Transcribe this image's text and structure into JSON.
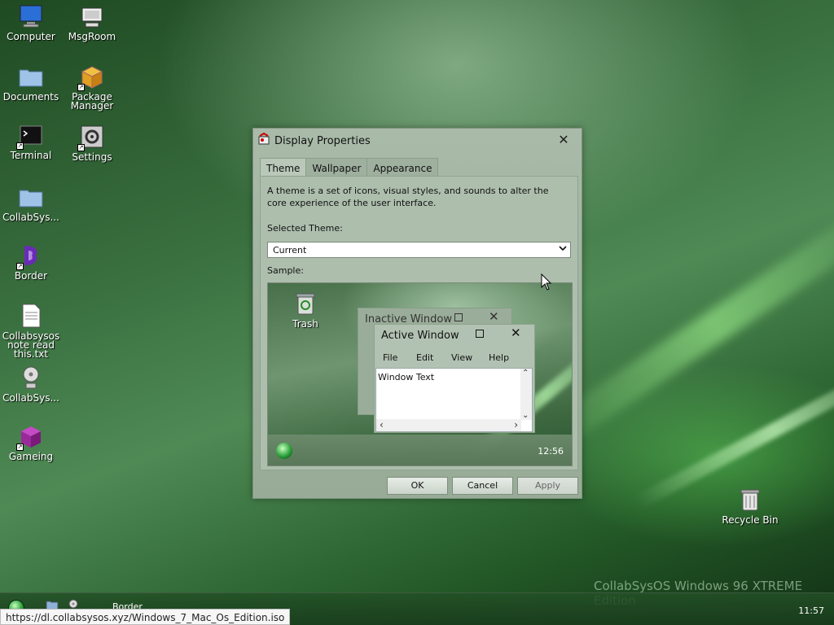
{
  "desktop": {
    "icons": [
      {
        "label": "Computer",
        "icon": "computer-icon",
        "shortcut": false
      },
      {
        "label": "MsgRoom",
        "icon": "msgroom-icon",
        "shortcut": false
      },
      {
        "label": "Documents",
        "icon": "folder-icon",
        "shortcut": false
      },
      {
        "label": "Package Manager",
        "icon": "package-icon",
        "shortcut": true
      },
      {
        "label": "Terminal",
        "icon": "terminal-icon",
        "shortcut": true
      },
      {
        "label": "Settings",
        "icon": "gear-icon",
        "shortcut": true
      },
      {
        "label": "CollabSys...",
        "icon": "folder-icon",
        "shortcut": false
      },
      {
        "label": "Border",
        "icon": "border-icon",
        "shortcut": true
      },
      {
        "label": "Collabsysos note read this.txt",
        "icon": "text-file-icon",
        "shortcut": false
      },
      {
        "label": "CollabSys...",
        "icon": "cd-icon",
        "shortcut": false
      },
      {
        "label": "Gameing",
        "icon": "cube-icon",
        "shortcut": true
      },
      {
        "label": "Recycle Bin",
        "icon": "recycle-bin-icon",
        "shortcut": false
      }
    ],
    "watermark": "CollabSysOS Windows 96 XTREME Edition"
  },
  "dialog": {
    "title": "Display Properties",
    "close_label": "✕",
    "tabs": [
      {
        "label": "Theme",
        "active": true
      },
      {
        "label": "Wallpaper",
        "active": false
      },
      {
        "label": "Appearance",
        "active": false
      }
    ],
    "description": "A theme is a set of icons, visual styles, and sounds to alter the core experience of the user interface.",
    "selected_theme_label": "Selected Theme:",
    "selected_theme_value": "Current",
    "sample_label": "Sample:",
    "sample": {
      "trash_label": "Trash",
      "inactive_window_title": "Inactive Window",
      "active_window_title": "Active Window",
      "menu": [
        "File",
        "Edit",
        "View",
        "Help"
      ],
      "window_text": "Window Text",
      "clock": "12:56"
    },
    "buttons": {
      "ok": "OK",
      "cancel": "Cancel",
      "apply": "Apply"
    }
  },
  "taskbar": {
    "task_label": "Border",
    "clock": "11:57"
  },
  "status_url": "https://dl.collabsysos.xyz/Windows_7_Mac_Os_Edition.iso",
  "colors": {
    "accent": "#2aa03a",
    "dialog_bg": "#a9baa9"
  }
}
